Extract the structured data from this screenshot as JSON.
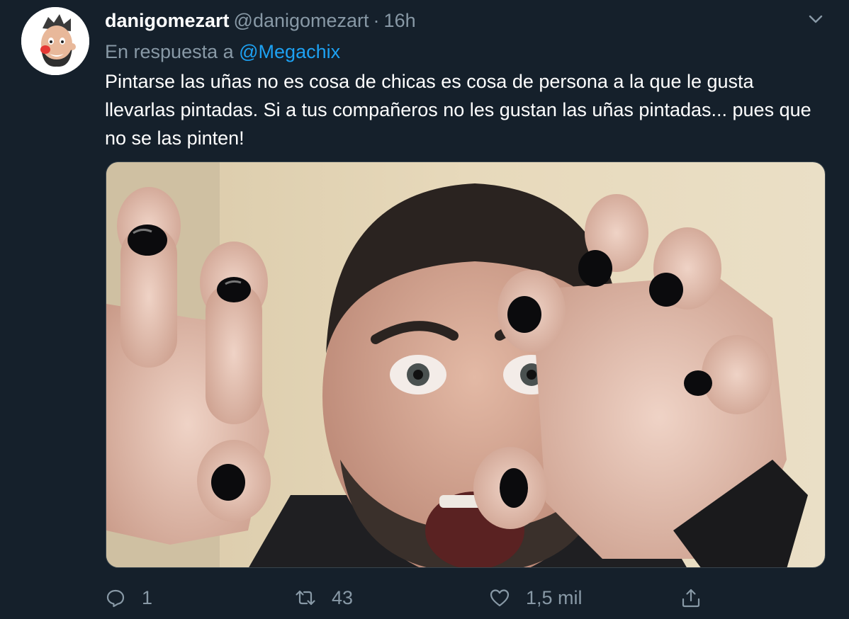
{
  "author": {
    "display_name": "danigomezart",
    "handle": "@danigomezart",
    "separator": "·",
    "time": "16h",
    "avatar_icon": "cartoon-avatar"
  },
  "reply": {
    "prefix": "En respuesta a",
    "mention": "@Megachix"
  },
  "tweet": {
    "text": "Pintarse las uñas no es cosa de chicas es cosa de persona a la que le gusta llevarlas pintadas. Si a tus compañeros no les gustan las uñas pintadas... pues que no se las pinten!"
  },
  "media": {
    "type": "photo",
    "description_icon": "photo"
  },
  "actions": {
    "replies": "1",
    "retweets": "43",
    "likes": "1,5 mil"
  },
  "colors": {
    "background": "#15202b",
    "text": "#ffffff",
    "muted": "#8899a6",
    "accent": "#1da1f2",
    "border": "#38444d"
  }
}
